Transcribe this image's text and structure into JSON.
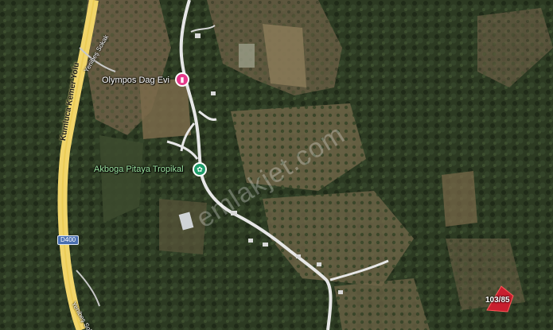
{
  "map": {
    "poi": {
      "olympos": {
        "label": "Olympos Dag Evi",
        "icon": "hotel-bed-icon",
        "color": "#e5388a"
      },
      "akboga": {
        "label": "Akboga Pitaya Tropikal",
        "icon": "flower-icon",
        "color": "#1f9d6a"
      }
    },
    "roads": {
      "highway_name": "Kumluca Kemer Yolu",
      "highway_shield": "D400",
      "side_road_top": "Yenibeş Sokak",
      "side_road_bottom": "Yenibeş Sokak"
    },
    "watermark": "emlakjet.com",
    "parcel": {
      "label": "103/85",
      "color": "#c81e2e"
    }
  }
}
